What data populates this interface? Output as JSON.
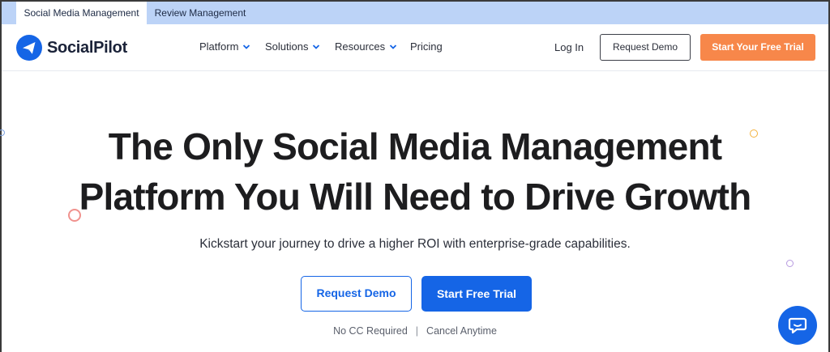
{
  "top_tabs": [
    {
      "label": "Social Media Management",
      "active": true
    },
    {
      "label": "Review Management",
      "active": false
    }
  ],
  "brand": {
    "name": "SocialPilot",
    "color": "#1565e6"
  },
  "nav": {
    "items": [
      {
        "label": "Platform",
        "has_dropdown": true
      },
      {
        "label": "Solutions",
        "has_dropdown": true
      },
      {
        "label": "Resources",
        "has_dropdown": true
      },
      {
        "label": "Pricing",
        "has_dropdown": false
      }
    ],
    "login": "Log In",
    "request_demo": "Request Demo",
    "free_trial": "Start Your Free Trial",
    "free_trial_color": "#f7874a"
  },
  "hero": {
    "title_line1": "The Only Social Media Management",
    "title_line2": "Platform You Will Need to Drive Growth",
    "subtitle": "Kickstart your journey to drive a higher ROI with enterprise-grade capabilities.",
    "cta_secondary": "Request Demo",
    "cta_primary": "Start Free Trial",
    "note_left": "No CC Required",
    "note_separator": "|",
    "note_right": "Cancel Anytime"
  },
  "icons": {
    "logo": "paper-plane-icon",
    "dropdown": "chevron-down-icon",
    "chat": "chat-bubble-icon"
  }
}
